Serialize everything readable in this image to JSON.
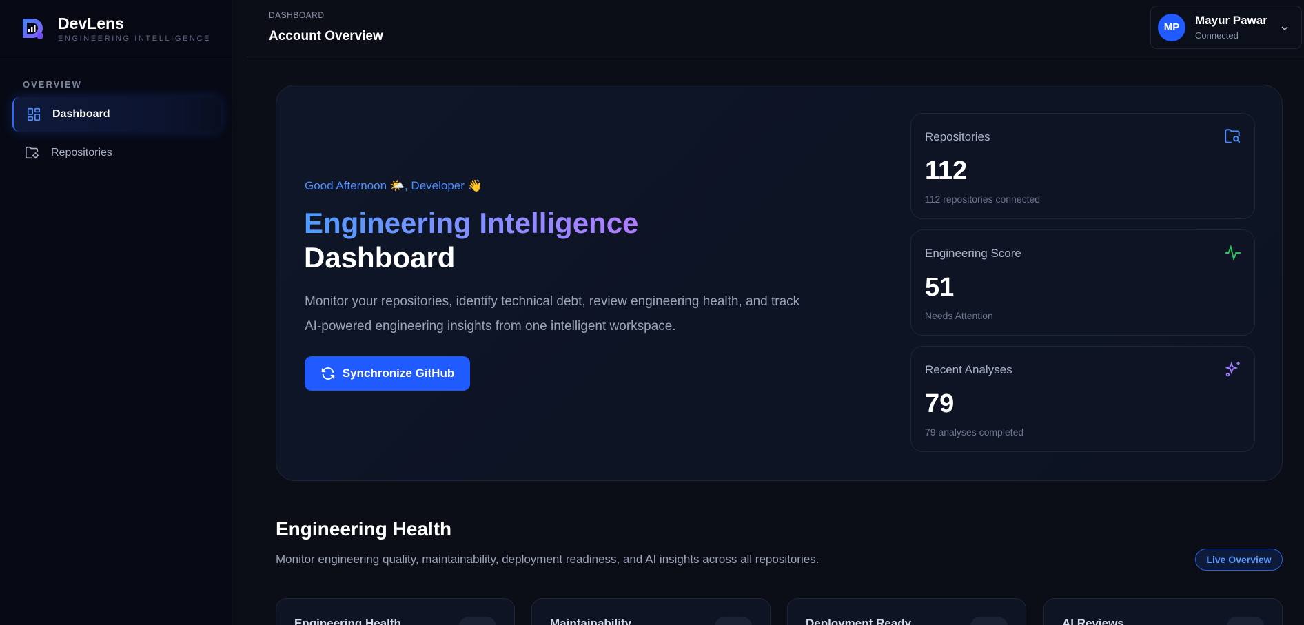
{
  "brand": {
    "name": "DevLens",
    "subtitle": "ENGINEERING INTELLIGENCE"
  },
  "sidebar": {
    "section": "OVERVIEW",
    "items": [
      {
        "label": "Dashboard",
        "icon": "dashboard-grid-icon",
        "active": true
      },
      {
        "label": "Repositories",
        "icon": "folder-git-icon",
        "active": false
      }
    ]
  },
  "header": {
    "breadcrumb": "DASHBOARD",
    "title": "Account Overview",
    "user": {
      "initials": "MP",
      "name": "Mayur Pawar",
      "status": "Connected"
    }
  },
  "hero": {
    "greeting": "Good Afternoon 🌤️, Developer 👋",
    "title_line1": "Engineering Intelligence",
    "title_line2": "Dashboard",
    "description": "Monitor your repositories, identify technical debt, review engineering health, and track AI-powered engineering insights from one intelligent workspace.",
    "sync_label": "Synchronize GitHub"
  },
  "stats": [
    {
      "label": "Repositories",
      "value": "112",
      "sub": "112 repositories connected",
      "icon": "folder-search-icon",
      "color": "#4d8dff"
    },
    {
      "label": "Engineering Score",
      "value": "51",
      "sub": "Needs Attention",
      "icon": "activity-icon",
      "color": "#22c55e"
    },
    {
      "label": "Recent Analyses",
      "value": "79",
      "sub": "79 analyses completed",
      "icon": "sparkles-icon",
      "color": "#a078ff"
    }
  ],
  "health": {
    "title": "Engineering Health",
    "description": "Monitor engineering quality, maintainability, deployment readiness, and AI insights across all repositories.",
    "badge": "Live Overview",
    "cards": [
      {
        "label": "Engineering Health"
      },
      {
        "label": "Maintainability"
      },
      {
        "label": "Deployment Ready"
      },
      {
        "label": "AI Reviews"
      }
    ]
  },
  "colors": {
    "accent": "#1f5bff",
    "background": "#0b0e17",
    "sidebar": "#070a14"
  }
}
